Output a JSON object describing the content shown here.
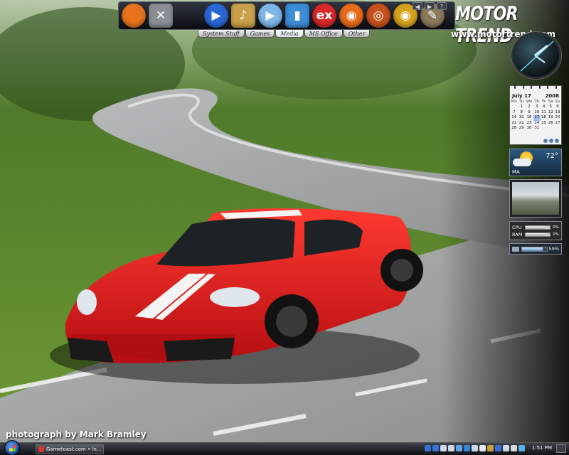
{
  "dock": {
    "icons": [
      {
        "name": "firefox-icon",
        "glyph": "",
        "bg": "#e8731c",
        "shape": "round"
      },
      {
        "name": "xfire-icon",
        "glyph": "✕",
        "bg": "#8a8f96",
        "shape": "square"
      },
      {
        "name": "gap",
        "glyph": "",
        "bg": "transparent",
        "shape": "none"
      },
      {
        "name": "media-player-icon",
        "glyph": "▶",
        "bg": "#2a66d6",
        "shape": "round"
      },
      {
        "name": "itunes-icon",
        "glyph": "♪",
        "bg": "#c9a14a",
        "shape": "square"
      },
      {
        "name": "quicktime-icon",
        "glyph": "▶",
        "bg": "#7fb8e8",
        "shape": "round"
      },
      {
        "name": "ipod-icon",
        "glyph": "▮",
        "bg": "#3c8cd8",
        "shape": "square"
      },
      {
        "name": "audio-ex-icon",
        "glyph": "ex",
        "bg": "#d82828",
        "shape": "round"
      },
      {
        "name": "headphones-icon",
        "glyph": "◉",
        "bg": "#e86a1a",
        "shape": "round"
      },
      {
        "name": "burn-disc-icon",
        "glyph": "◎",
        "bg": "#c8501c",
        "shape": "round"
      },
      {
        "name": "eye-icon",
        "glyph": "◉",
        "bg": "#d6a41c",
        "shape": "round"
      },
      {
        "name": "gimp-icon",
        "glyph": "✎",
        "bg": "#8a7a5a",
        "shape": "round"
      }
    ],
    "controls": [
      "◀",
      "▶",
      "?"
    ],
    "tabs": [
      {
        "label": "System Stuff",
        "active": false
      },
      {
        "label": "Games",
        "active": false
      },
      {
        "label": "Media",
        "active": true
      },
      {
        "label": "MS Office",
        "active": false
      },
      {
        "label": "Other",
        "active": false
      }
    ]
  },
  "brand": {
    "logo": "MOTOR TREND",
    "url": "www.motortrend.com"
  },
  "calendar": {
    "month": "July 17",
    "year": "2008",
    "weekdays": [
      "Mo",
      "Tu",
      "We",
      "Th",
      "Fr",
      "Sa",
      "Su"
    ],
    "weeks": [
      [
        "",
        "1",
        "2",
        "3",
        "4",
        "5",
        "6"
      ],
      [
        "7",
        "8",
        "9",
        "10",
        "11",
        "12",
        "13"
      ],
      [
        "14",
        "15",
        "16",
        "17",
        "18",
        "19",
        "20"
      ],
      [
        "21",
        "22",
        "23",
        "24",
        "25",
        "26",
        "27"
      ],
      [
        "28",
        "29",
        "30",
        "31",
        "",
        "",
        ""
      ]
    ],
    "today": "17"
  },
  "weather": {
    "temp": "72°",
    "location": "MA"
  },
  "meter": {
    "cpu_label": "CPU",
    "ram_label": "RAM",
    "cpu_percent": 80,
    "ram_percent": 80,
    "cpu_value": "0%",
    "ram_value": "0%"
  },
  "drive": {
    "percent": 85,
    "value": "59%"
  },
  "credit": "photograph by Mark Bramley",
  "taskbar": {
    "task_label": "Gametoast.com • In...",
    "clock": "1:51 PM",
    "tray_colors": [
      "#3b6fd6",
      "#3b6fd6",
      "#cfd8e8",
      "#cfd8e8",
      "#6aa0e8",
      "#2f8ad8",
      "#cfd8e8",
      "#e8e8e8",
      "#c8a040",
      "#3b6fd6",
      "#cfd8e8",
      "#d8d8d8",
      "#5ab0e8"
    ]
  },
  "colors": {
    "car_red": "#d8141c",
    "grass": "#5f8a2e",
    "road": "#9c9f9e"
  }
}
